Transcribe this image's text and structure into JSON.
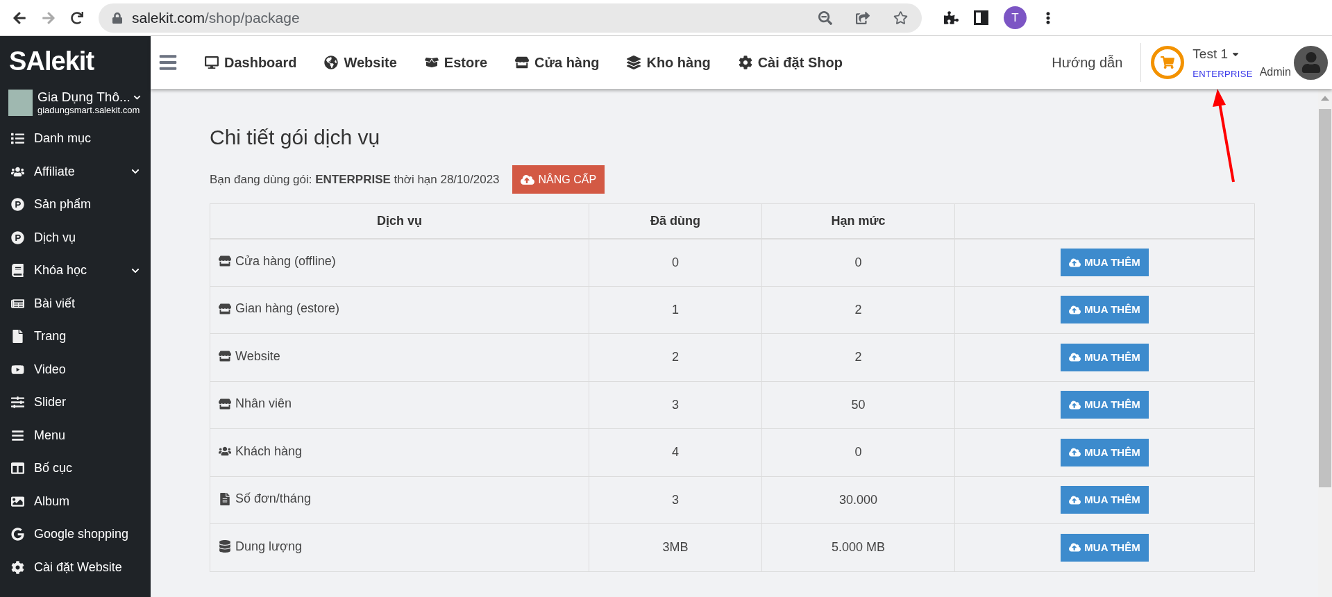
{
  "browser": {
    "url_domain": "salekit.com",
    "url_path": "/shop/package",
    "back_disabled": false,
    "forward_disabled": true,
    "profile_initial": "T"
  },
  "sidebar": {
    "logo": "SAlekit",
    "shop_name": "Gia Dụng Thô...",
    "shop_domain": "giadungsmart.salekit.com",
    "items": [
      {
        "label": "Danh mục",
        "expandable": false
      },
      {
        "label": "Affiliate",
        "expandable": true
      },
      {
        "label": "Sản phẩm",
        "expandable": false
      },
      {
        "label": "Dịch vụ",
        "expandable": false
      },
      {
        "label": "Khóa học",
        "expandable": true
      },
      {
        "label": "Bài viết",
        "expandable": false
      },
      {
        "label": "Trang",
        "expandable": false
      },
      {
        "label": "Video",
        "expandable": false
      },
      {
        "label": "Slider",
        "expandable": false
      },
      {
        "label": "Menu",
        "expandable": false
      },
      {
        "label": "Bố cục",
        "expandable": false
      },
      {
        "label": "Album",
        "expandable": false
      },
      {
        "label": "Google shopping",
        "expandable": false
      },
      {
        "label": "Cài đặt Website",
        "expandable": false
      }
    ]
  },
  "topnav": {
    "items": [
      "Dashboard",
      "Website",
      "Estore",
      "Cửa hàng",
      "Kho hàng",
      "Cài đặt Shop"
    ],
    "guide": "Hướng dẫn",
    "account": "Test 1",
    "plan": "ENTERPRISE",
    "role": "Admin"
  },
  "content": {
    "title": "Chi tiết gói dịch vụ",
    "plan_text": "Bạn đang dùng gói: **ENTERPRISE** thời hạn 28/10/2023",
    "upgrade_button": "NÂNG CẤP",
    "table": {
      "columns": [
        "Dịch vụ",
        "Đã dùng",
        "Hạn mức"
      ],
      "rows": [
        {
          "service": "Cửa hàng (offline)",
          "used": "0",
          "limit": "0",
          "button": "MUA THÊM"
        },
        {
          "service": "Gian hàng (estore)",
          "used": "1",
          "limit": "2",
          "button": "MUA THÊM"
        },
        {
          "service": "Website",
          "used": "2",
          "limit": "2",
          "button": "MUA THÊM"
        },
        {
          "service": "Nhân viên",
          "used": "3",
          "limit": "50",
          "button": "MUA THÊM"
        },
        {
          "service": "Khách hàng",
          "used": "4",
          "limit": "0",
          "button": "MUA THÊM"
        },
        {
          "service": "Số đơn/tháng",
          "used": "3",
          "limit": "30.000",
          "button": "MUA THÊM"
        },
        {
          "service": "Dung lượng",
          "used": "3MB",
          "limit": "5.000 MB",
          "button": "MUA THÊM"
        }
      ]
    }
  }
}
